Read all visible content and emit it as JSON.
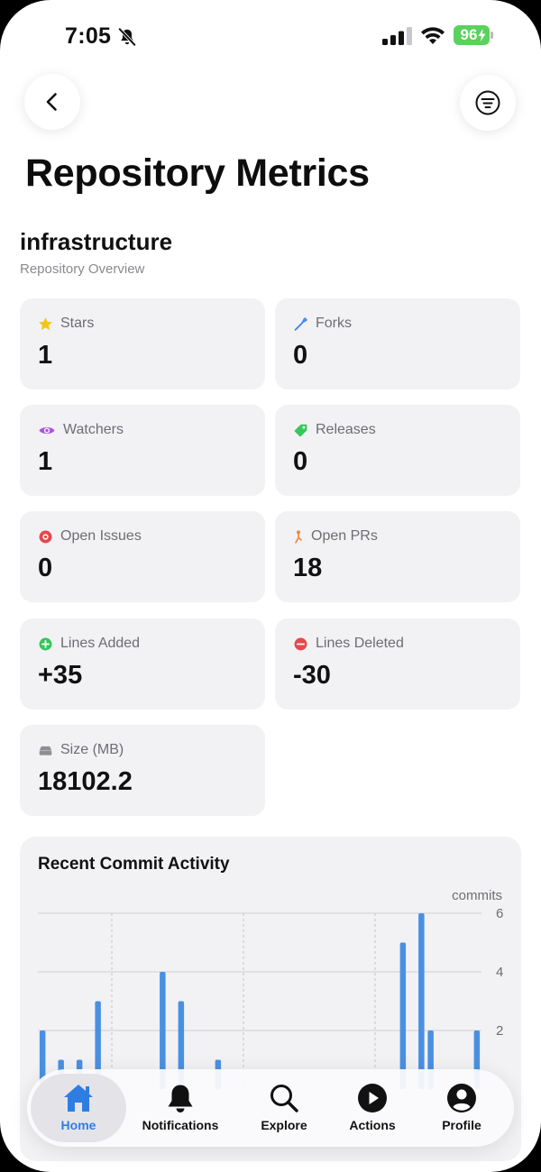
{
  "status_bar": {
    "time": "7:05",
    "battery": "96"
  },
  "page": {
    "title": "Repository Metrics"
  },
  "repo": {
    "name": "infrastructure",
    "subtitle": "Repository Overview"
  },
  "metrics": [
    {
      "label": "Stars",
      "value": "1",
      "icon": "star-icon",
      "color": "#f5c518"
    },
    {
      "label": "Forks",
      "value": "0",
      "icon": "fork-icon",
      "color": "#3b82f6"
    },
    {
      "label": "Watchers",
      "value": "1",
      "icon": "eye-icon",
      "color": "#af52de"
    },
    {
      "label": "Releases",
      "value": "0",
      "icon": "tag-icon",
      "color": "#34c759"
    },
    {
      "label": "Open Issues",
      "value": "0",
      "icon": "issue-icon",
      "color": "#e5484d"
    },
    {
      "label": "Open PRs",
      "value": "18",
      "icon": "pull-request-icon",
      "color": "#f0883e"
    },
    {
      "label": "Lines Added",
      "value": "+35",
      "icon": "plus-circle-icon",
      "color": "#34c759"
    },
    {
      "label": "Lines Deleted",
      "value": "-30",
      "icon": "minus-circle-icon",
      "color": "#e5484d"
    },
    {
      "label": "Size (MB)",
      "value": "18102.2",
      "icon": "drive-icon",
      "color": "#8e8e93"
    }
  ],
  "chart": {
    "title": "Recent Commit Activity",
    "unit_label": "commits",
    "bar_color": "#4a90e2"
  },
  "chart_data": {
    "type": "bar",
    "title": "Recent Commit Activity",
    "ylabel": "commits",
    "ylim": [
      0,
      6
    ],
    "yticks": [
      "6",
      "4",
      "2"
    ],
    "values": [
      2,
      0,
      1,
      0,
      1,
      0,
      3,
      0,
      0,
      0,
      0,
      0,
      0,
      4,
      0,
      3,
      0,
      0,
      0,
      1,
      0,
      0,
      0,
      0,
      0,
      0,
      0,
      0,
      0,
      0,
      0,
      0,
      0,
      0,
      0,
      0,
      0,
      0,
      0,
      5,
      0,
      6,
      2,
      0,
      0,
      0,
      0,
      2
    ]
  },
  "tabs": [
    {
      "label": "Home",
      "icon": "home-icon",
      "active": true
    },
    {
      "label": "Notifications",
      "icon": "bell-icon",
      "active": false
    },
    {
      "label": "Explore",
      "icon": "search-icon",
      "active": false
    },
    {
      "label": "Actions",
      "icon": "play-icon",
      "active": false
    },
    {
      "label": "Profile",
      "icon": "profile-icon",
      "active": false
    }
  ]
}
